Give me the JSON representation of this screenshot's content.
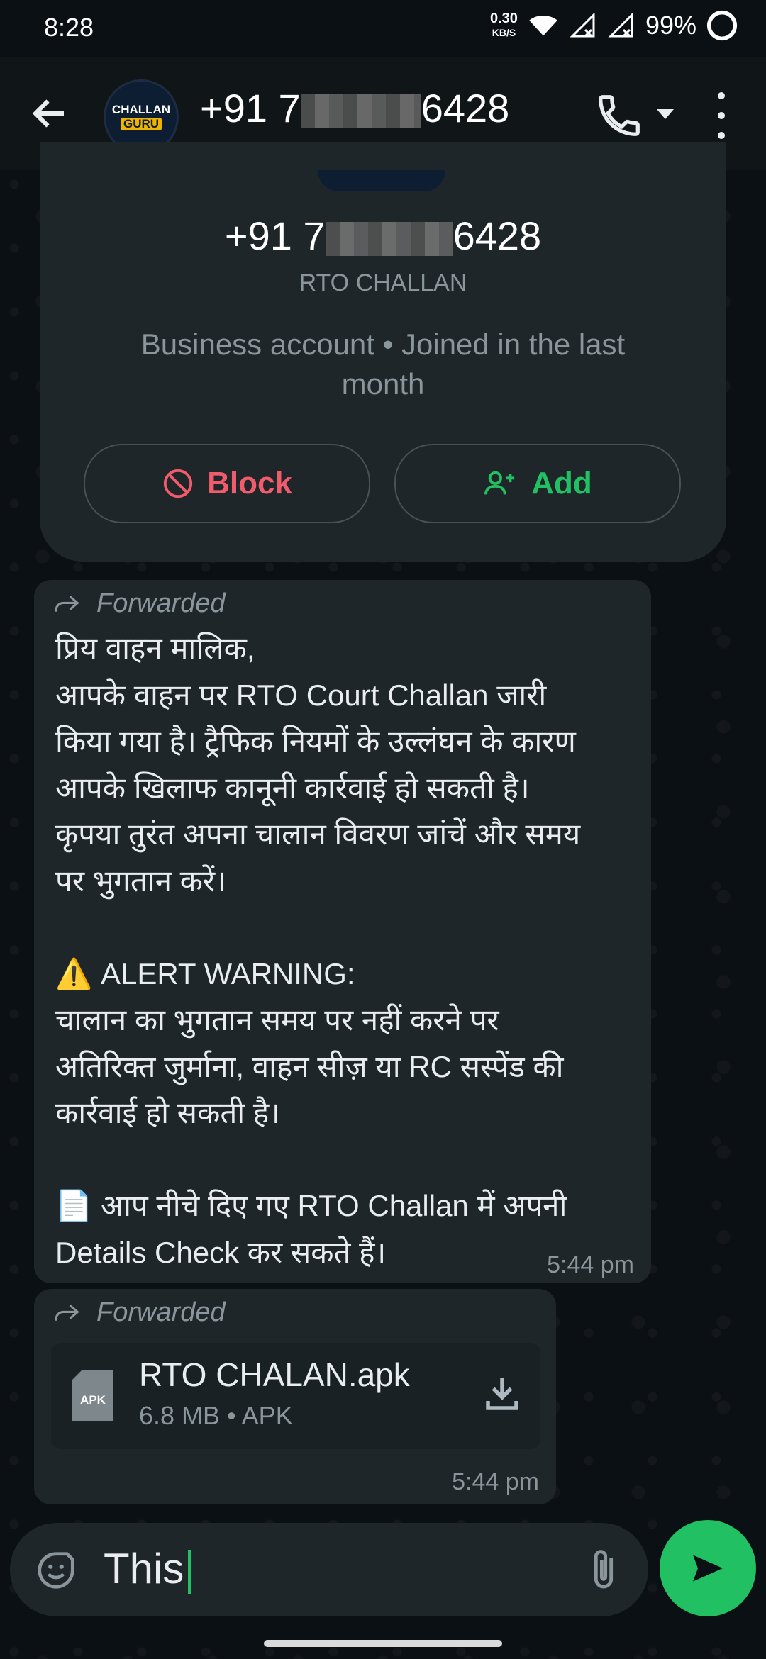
{
  "status": {
    "time": "8:28",
    "net_speed_value": "0.30",
    "net_speed_unit": "KB/S",
    "battery": "99%"
  },
  "header": {
    "contact_prefix": "+91 7",
    "contact_suffix": "6428",
    "avatar_line1": "CHALLAN",
    "avatar_line2": "GURU"
  },
  "profile": {
    "number_prefix": "+91 7",
    "number_suffix": "6428",
    "name": "RTO CHALLAN",
    "meta": "Business account • Joined in the last month",
    "block_label": "Block",
    "add_label": "Add"
  },
  "messages": [
    {
      "forwarded_label": "Forwarded",
      "text": "प्रिय वाहन मालिक,\nआपके वाहन पर RTO Court Challan जारी\nकिया गया है। ट्रैफिक नियमों के उल्लंघन के कारण\nआपके खिलाफ कानूनी कार्रवाई हो सकती है।\nकृपया तुरंत अपना चालान विवरण जांचें और समय\nपर भुगतान करें।\n\n⚠️ ALERT WARNING:\nचालान का भुगतान समय पर नहीं करने पर\nअतिरिक्त जुर्माना, वाहन सीज़ या RC सस्पेंड की\nकार्रवाई हो सकती है।\n\n📄 आप नीचे दिए गए RTO Challan में अपनी\nDetails Check कर सकते हैं।",
      "time": "5:44 pm"
    },
    {
      "forwarded_label": "Forwarded",
      "file_name": "RTO CHALAN.apk",
      "file_meta": "6.8 MB • APK",
      "file_icon_label": "APK",
      "time": "5:44 pm"
    }
  ],
  "composer": {
    "input_value": "This"
  },
  "colors": {
    "accent": "#21c063",
    "danger": "#f15c6d",
    "bubble": "#1f2629",
    "background": "#0b1014"
  }
}
